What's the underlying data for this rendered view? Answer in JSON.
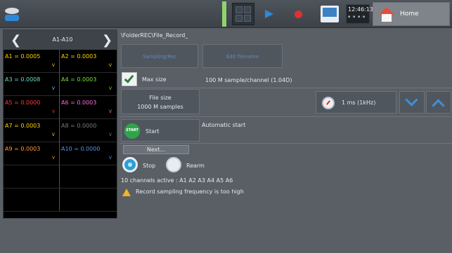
{
  "header": {
    "clock": "12:46:13",
    "clock_sub": "▪ ▪ ▪ ▪",
    "home_label": "Home"
  },
  "channel_panel": {
    "title": "A1-A10",
    "prev_glyph": "❮",
    "next_glyph": "❯",
    "channels": [
      {
        "text": "A1 = 0.0005",
        "unit": "V",
        "color": "#ffd400"
      },
      {
        "text": "A2 = 0.0003",
        "unit": "V",
        "color": "#ffd400"
      },
      {
        "text": "A3 = 0.0008",
        "unit": "V",
        "color": "#5fe0d2"
      },
      {
        "text": "A4 = 0.0003",
        "unit": "V",
        "color": "#7de23a"
      },
      {
        "text": "A5 = 0.0000",
        "unit": "V",
        "color": "#ff3b3b"
      },
      {
        "text": "A6 = 0.0003",
        "unit": "V",
        "color": "#ff6fd8"
      },
      {
        "text": "A7 = 0.0003",
        "unit": "V",
        "color": "#ffd400"
      },
      {
        "text": "A8 = 0.0000",
        "unit": "V",
        "color": "#7a7a7a"
      },
      {
        "text": "A9 = 0.0003",
        "unit": "V",
        "color": "#ff9a2e"
      },
      {
        "text": "A10 = 0.0000",
        "unit": "V",
        "color": "#5f8fe0"
      }
    ]
  },
  "main": {
    "path": "\\FolderREC\\File_Record_",
    "button1_label": "Sampling/Rec",
    "button2_label": "Edit filename",
    "max_size_label": "Max size",
    "samples_text": "100 M sample/channel  (1.04D)",
    "file_size_line1": "File size",
    "file_size_line2": "1000 M samples",
    "rate_label": "1 ms (1kHz)",
    "start_circle": "START",
    "start_label": "Start",
    "automatic_start": "Automatic start",
    "next_label": "Next...",
    "stop_label": "Stop",
    "rearm_label": "Rearm",
    "channels_active": "10 channels active : A1 A2 A3 A4 A5 A6",
    "warning": "Record sampling frequency is too high"
  }
}
